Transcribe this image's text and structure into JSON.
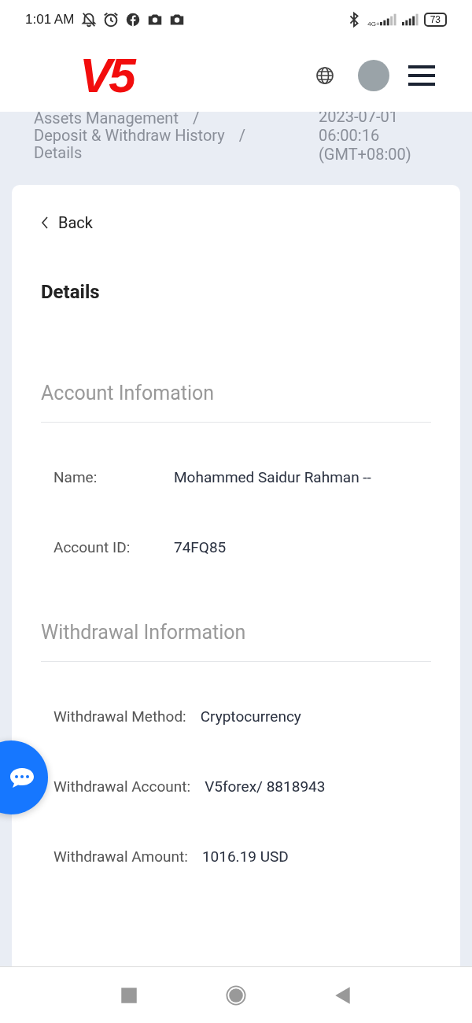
{
  "status_bar": {
    "time": "1:01 AM",
    "network": "4G+",
    "battery": "73"
  },
  "header": {
    "logo": "V5"
  },
  "breadcrumb": [
    {
      "label": "Assets Management",
      "separator": "/"
    },
    {
      "label": "Deposit & Withdraw History",
      "separator": "/"
    },
    {
      "label": "Details"
    }
  ],
  "timestamp": [
    "2023-07-01",
    "06:00:16",
    "(GMT+08:00)"
  ],
  "back": "Back",
  "title": "Details",
  "sections": [
    {
      "title": "Account Infomation",
      "fields": [
        {
          "label": "Name:",
          "value": "Mohammed Saidur Rahman --"
        },
        {
          "label": "Account ID:",
          "value": "74FQ85"
        }
      ]
    },
    {
      "title": "Withdrawal Information",
      "fields": [
        {
          "label": "Withdrawal Method:",
          "value": "Cryptocurrency"
        },
        {
          "label": "Withdrawal Account:",
          "value": "V5forex/ 8818943"
        },
        {
          "label": "Withdrawal Amount:",
          "value": "1016.19 USD"
        }
      ]
    }
  ]
}
